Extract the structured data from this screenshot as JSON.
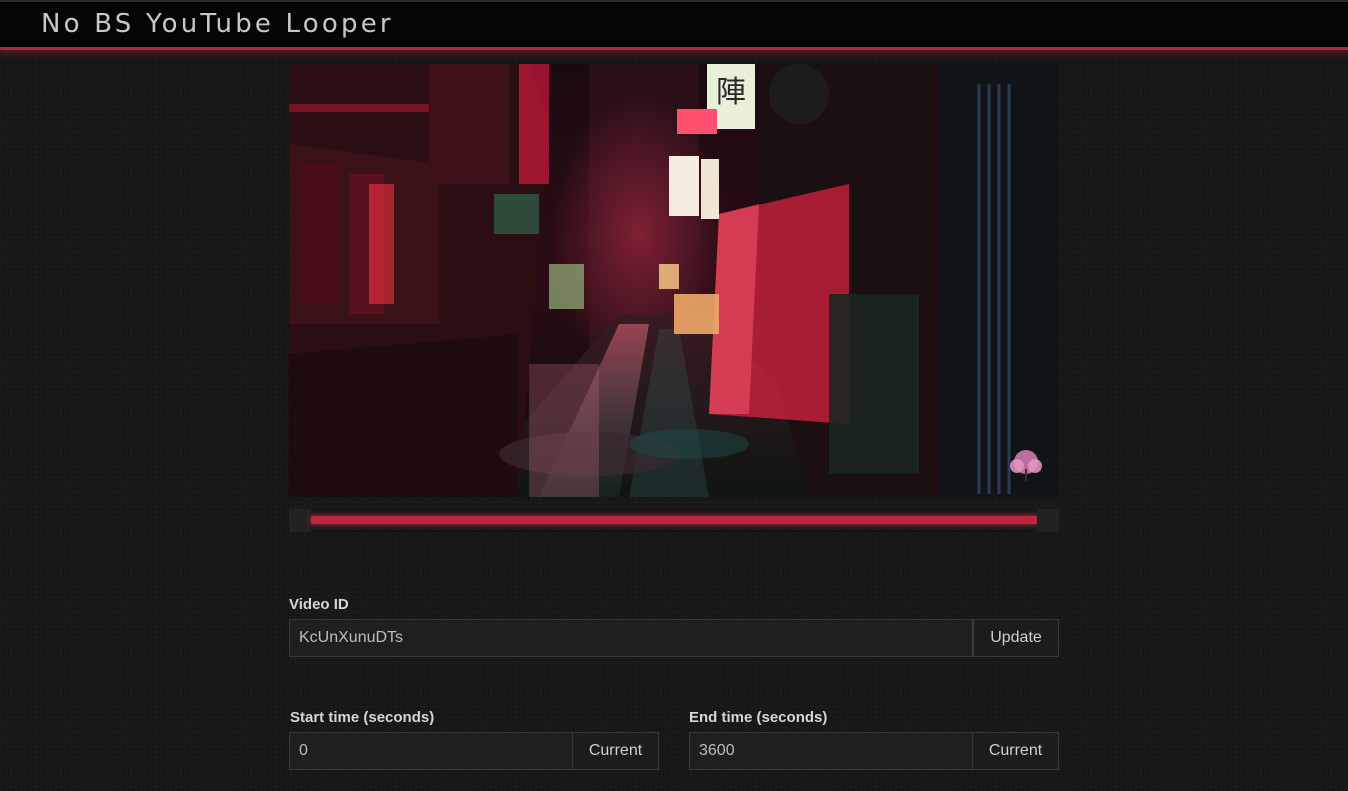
{
  "app": {
    "title": "No BS YouTube Looper"
  },
  "player": {
    "thumbnail": "neon-rainy-alley-night-scene",
    "progress": 1.0
  },
  "video_id": {
    "label": "Video ID",
    "value": "KcUnXunuDTs",
    "button": "Update"
  },
  "start_time": {
    "label": "Start time (seconds)",
    "value": "0",
    "button": "Current"
  },
  "end_time": {
    "label": "End time (seconds)",
    "value": "3600",
    "button": "Current"
  },
  "colors": {
    "accent": "#c0263f",
    "background": "#171717",
    "header": "#050505"
  }
}
